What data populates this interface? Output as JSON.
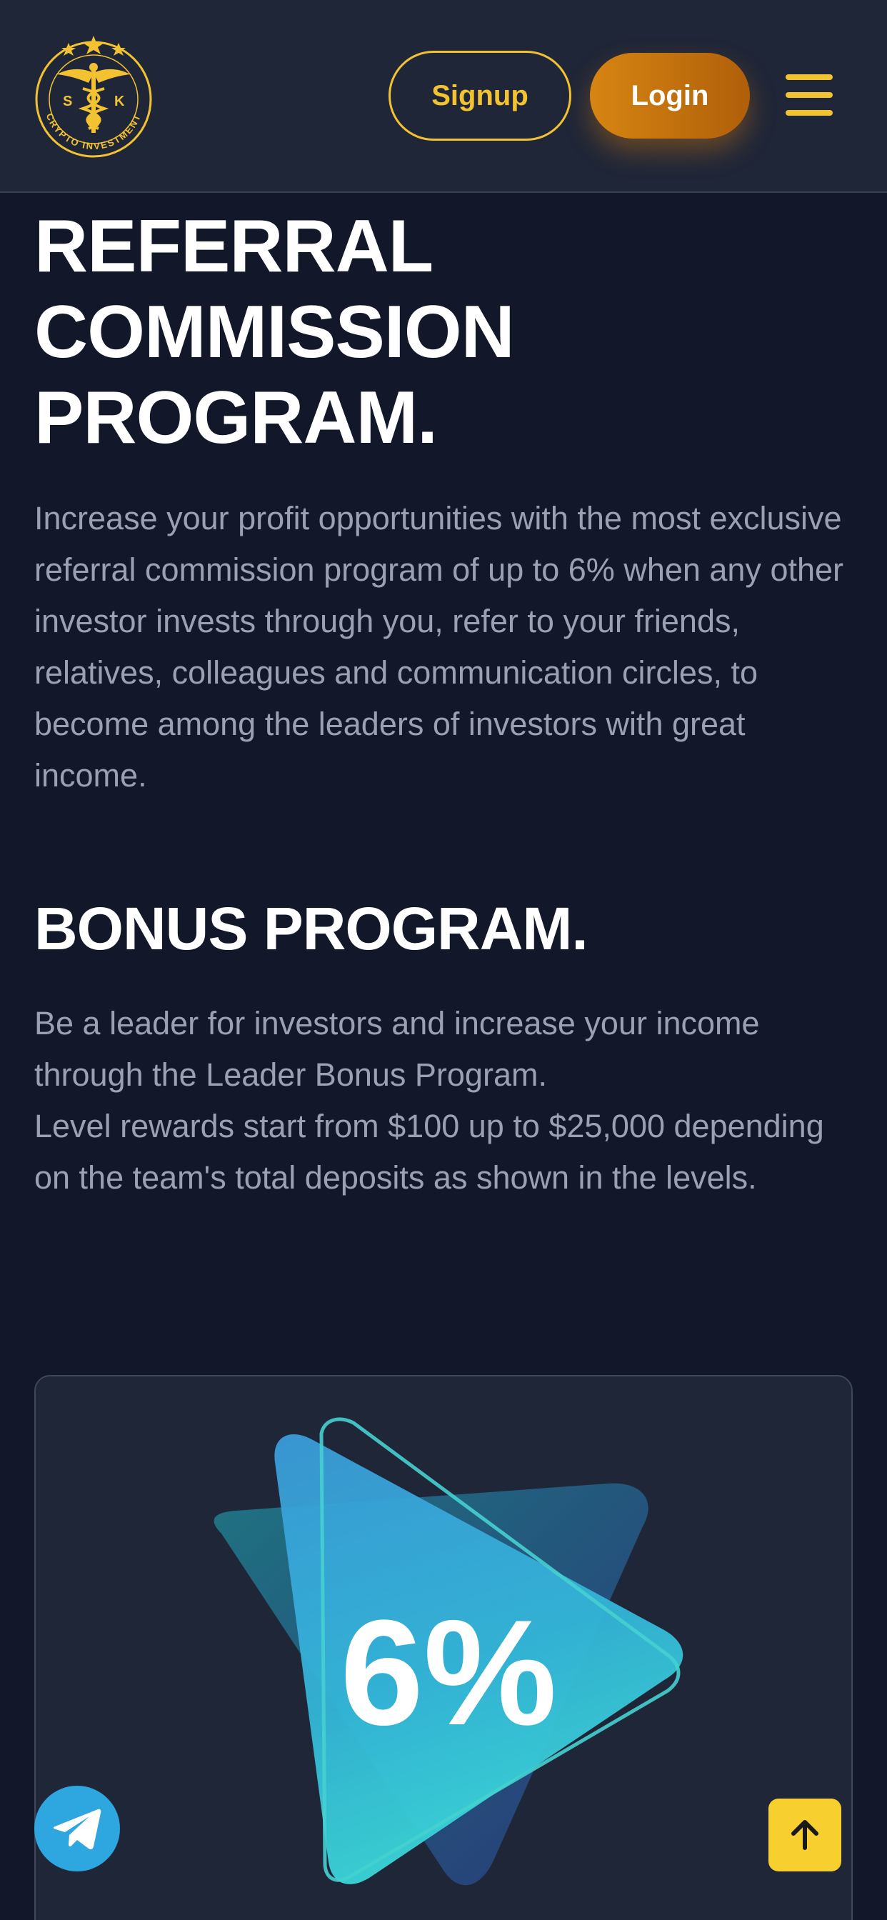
{
  "header": {
    "logo": {
      "initials": [
        "S",
        "K"
      ],
      "ring_text": "CRYPTO INVESTMENT",
      "icon": "caduceus-logo"
    },
    "signup_label": "Signup",
    "login_label": "Login",
    "menu_icon": "hamburger-menu-icon"
  },
  "referral": {
    "title": "REFERRAL\nCOMMISSION\nPROGRAM.",
    "description": "Increase your profit opportunities with the most exclusive referral commission program of up to 6% when any other investor invests through you, refer to your friends, relatives, colleagues and communication circles, to become among the leaders of investors with great income."
  },
  "bonus": {
    "title": "BONUS PROGRAM.",
    "description_1": "Be a leader for investors and increase your income through the Leader Bonus Program.",
    "description_2": "Level rewards start from $100 up to $25,000 depending on the team's total deposits as shown in the levels."
  },
  "card": {
    "percent": "6%"
  },
  "floating": {
    "telegram_icon": "telegram-icon",
    "scroll_top_icon": "arrow-up-icon"
  },
  "colors": {
    "background": "#121829",
    "header_bg": "#1f2638",
    "accent_yellow": "#f2c230",
    "login_orange": "#d68512",
    "body_text": "#9ba1b2",
    "telegram_blue": "#2ea6df"
  }
}
